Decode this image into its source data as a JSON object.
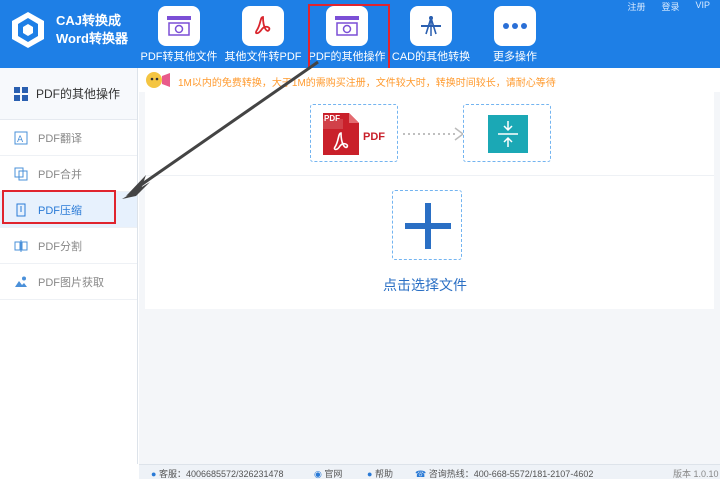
{
  "app": {
    "title_line1": "CAJ转换成",
    "title_line2": "Word转换器"
  },
  "top_links": [
    "注册",
    "登录",
    "VIP"
  ],
  "nav": [
    {
      "label": "PDF转其他文件",
      "icon": "pdf-settings-icon"
    },
    {
      "label": "其他文件转PDF",
      "icon": "acrobat-icon"
    },
    {
      "label": "PDF的其他操作",
      "icon": "pdf-settings-icon"
    },
    {
      "label": "CAD的其他转换",
      "icon": "cad-compass-icon"
    },
    {
      "label": "更多操作",
      "icon": "more-dots-icon"
    }
  ],
  "notice": "1M以内的免费转换，大于1M的需购买注册，文件较大时，转换时间较长，请耐心等待",
  "sidebar": {
    "header": "PDF的其他操作",
    "items": [
      {
        "label": "PDF翻译",
        "icon": "translate-icon"
      },
      {
        "label": "PDF合并",
        "icon": "merge-icon"
      },
      {
        "label": "PDF压缩",
        "icon": "compress-icon"
      },
      {
        "label": "PDF分割",
        "icon": "split-icon"
      },
      {
        "label": "PDF图片获取",
        "icon": "image-extract-icon"
      }
    ]
  },
  "main": {
    "pdf_text": "PDF",
    "pdf_badge": "PDF",
    "select_file": "点击选择文件"
  },
  "status": {
    "service": "客服：4006685572/326231478",
    "website": "官网",
    "help": "帮助",
    "hotline": "咨询热线：400-668-5572/181-2107-4602",
    "version": "版本 1.0.10"
  },
  "colors": {
    "header_blue": "#1e7fe6",
    "accent_red": "#e0242e",
    "notice_orange": "#ff9a2e",
    "active_bg": "#e7f1fd",
    "teal": "#1ba8b5"
  }
}
